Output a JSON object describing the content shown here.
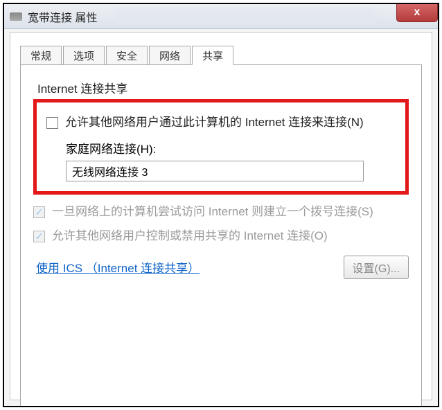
{
  "window": {
    "title": "宽带连接 属性",
    "close_label": "x"
  },
  "tabs": [
    {
      "label": "常规"
    },
    {
      "label": "选项"
    },
    {
      "label": "安全"
    },
    {
      "label": "网络"
    },
    {
      "label": "共享"
    }
  ],
  "sharing": {
    "group_title": "Internet 连接共享",
    "allow_others": {
      "label": "允许其他网络用户通过此计算机的 Internet 连接来连接(N)",
      "checked": false
    },
    "home_network_label": "家庭网络连接(H):",
    "home_network_selected": "无线网络连接 3",
    "dial_on_demand": {
      "label": "一旦网络上的计算机尝试访问 Internet 则建立一个拨号连接(S)",
      "checked": true
    },
    "allow_control": {
      "label": "允许其他网络用户控制或禁用共享的 Internet 连接(O)",
      "checked": true
    },
    "ics_link": "使用 ICS （Internet 连接共享）",
    "settings_button": "设置(G)..."
  }
}
